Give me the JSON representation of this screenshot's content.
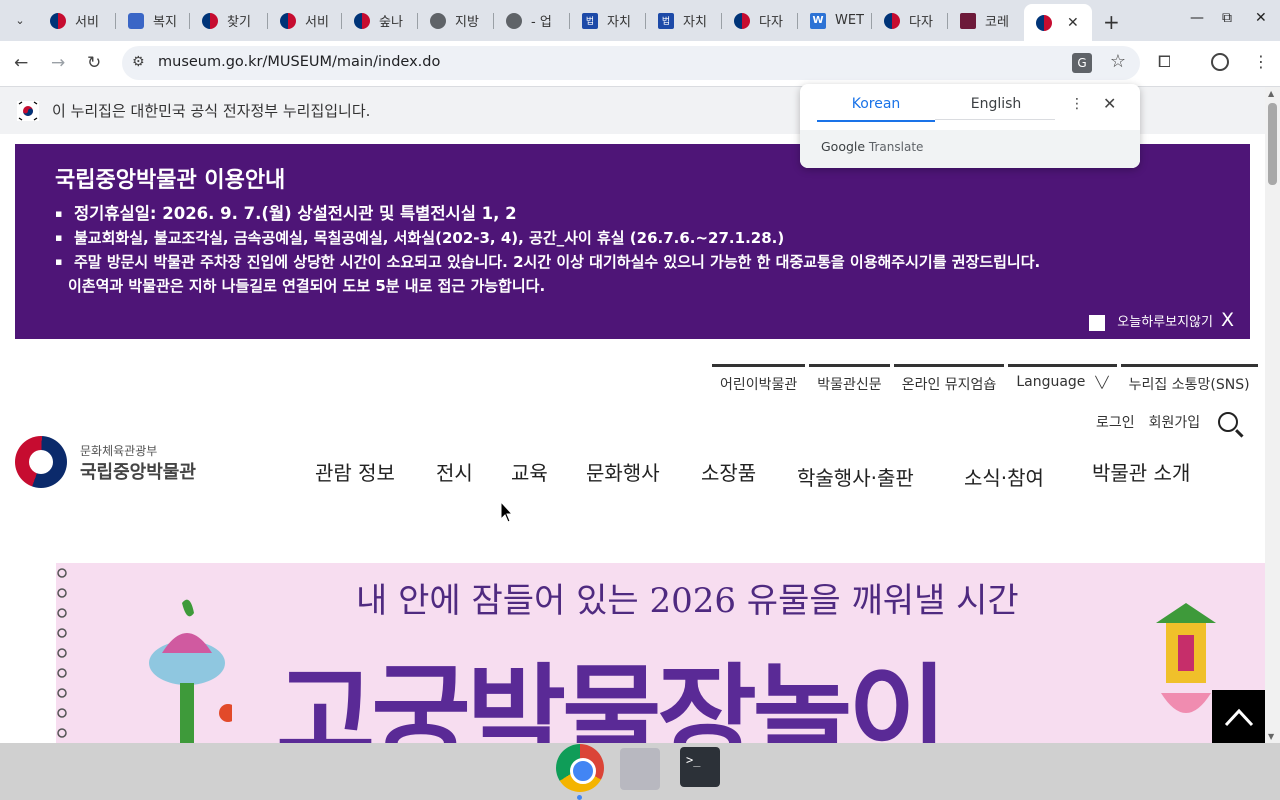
{
  "browser": {
    "tabs": [
      {
        "title": "서비",
        "icon": "gov-icon"
      },
      {
        "title": "복지",
        "icon": "site-icon"
      },
      {
        "title": "찾기",
        "icon": "gov-icon"
      },
      {
        "title": "서비",
        "icon": "gov-icon"
      },
      {
        "title": "숲나",
        "icon": "gov-icon"
      },
      {
        "title": "지방",
        "icon": "globe-icon"
      },
      {
        "title": "- 업",
        "icon": "globe-icon"
      },
      {
        "title": "자치",
        "icon": "law-icon"
      },
      {
        "title": "자치",
        "icon": "law-icon"
      },
      {
        "title": "다자",
        "icon": "gov-icon"
      },
      {
        "title": "WET",
        "icon": "w-icon"
      },
      {
        "title": "다자",
        "icon": "gov-icon"
      },
      {
        "title": "코레",
        "icon": "rail-icon"
      },
      {
        "title": "",
        "icon": "gov-icon",
        "active": true
      }
    ],
    "url": "museum.go.kr/MUSEUM/main/index.do"
  },
  "translate_popup": {
    "tab_source": "Korean",
    "tab_target": "English",
    "brand": "Google",
    "brand_suffix": "Translate"
  },
  "gov_banner": {
    "text": "이 누리집은 대한민국 공식 전자정부 누리집입니다."
  },
  "notice": {
    "title": "국립중앙박물관 이용안내",
    "items": [
      "정기휴실일: 2026. 9. 7.(월) 상설전시관 및 특별전시실 1, 2",
      "불교회화실, 불교조각실, 금속공예실, 목칠공예실, 서화실(202-3, 4), 공간_사이 휴실 (26.7.6.~27.1.28.)",
      "주말 방문시 박물관 주차장 진입에 상당한 시간이 소요되고 있습니다. 2시간 이상 대기하실수 있으니 가능한 한 대중교통을 이용해주시기를 권장드립니다."
    ],
    "item3_line2": "이촌역과 박물관은 지하 나들길로 연결되어 도보 5분 내로 접근 가능합니다.",
    "dont_show_label": "오늘하루보지않기",
    "close_label": "X"
  },
  "util_links": [
    "어린이박물관",
    "박물관신문",
    "온라인 뮤지엄숍",
    "Language",
    "누리집 소통망(SNS)"
  ],
  "account": {
    "login": "로그인",
    "signup": "회원가입"
  },
  "logo": {
    "sub": "문화체육관광부",
    "main": "국립중앙박물관"
  },
  "gnb": [
    "관람 정보",
    "전시",
    "교육",
    "문화행사",
    "소장품",
    "학술행사·출판",
    "소식·참여",
    "박물관 소개"
  ],
  "hero": {
    "tagline": "내 안에 잠들어 있는 2026 유물을 깨워낼 시간",
    "headline": "고궁박물장놀이"
  },
  "colors": {
    "notice_bg": "#4e1577",
    "hero_bg": "#f7ddf0",
    "hero_text": "#5a2a96"
  }
}
